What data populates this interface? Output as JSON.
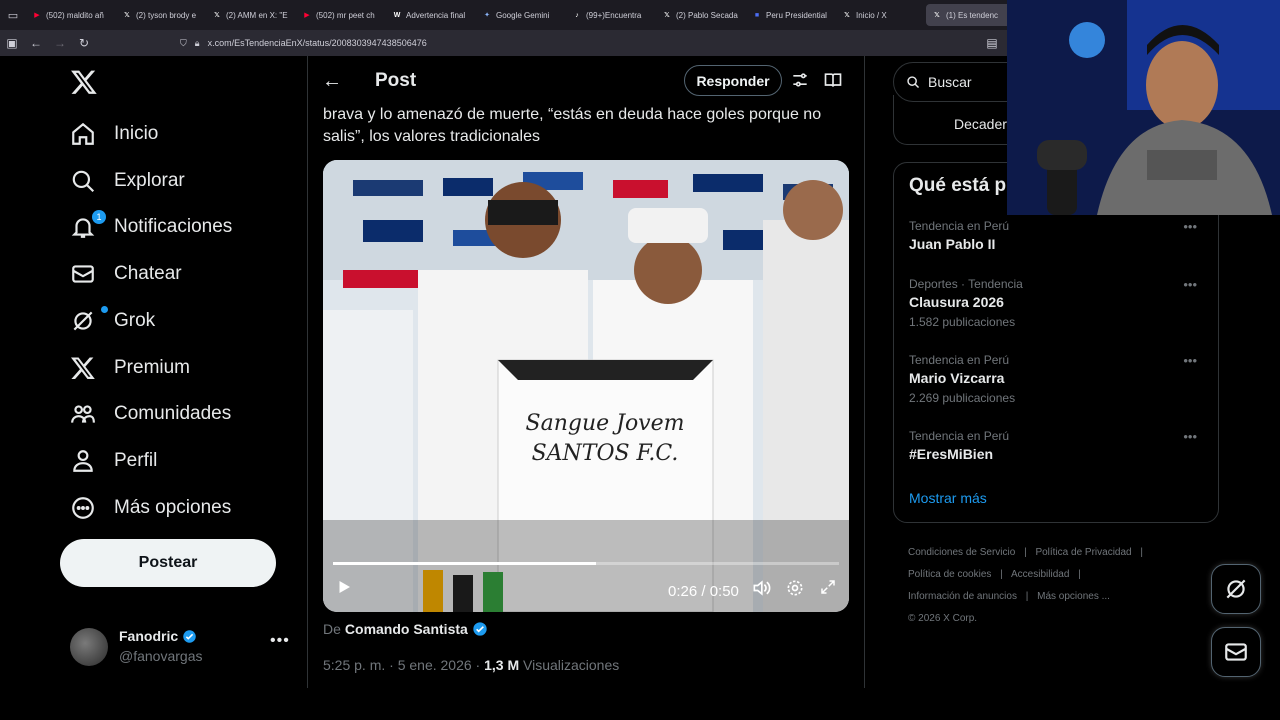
{
  "browser": {
    "tabs": [
      {
        "label": "(502) maldito añ",
        "icon": "youtube-icon",
        "color": "#ff0033"
      },
      {
        "label": "(2) tyson brody e",
        "icon": "x-icon",
        "color": "#ffffff"
      },
      {
        "label": "(2) AMM en X: \"E",
        "icon": "x-icon",
        "color": "#ffffff"
      },
      {
        "label": "(502) mr peet ch",
        "icon": "youtube-icon",
        "color": "#ff0033"
      },
      {
        "label": "Advertencia final",
        "icon": "wikipedia-icon",
        "color": "#ffffff"
      },
      {
        "label": "Google Gemini",
        "icon": "gemini-icon",
        "color": "#8ab4f8"
      },
      {
        "label": "(99+)Encuentra",
        "icon": "tiktok-icon",
        "color": "#ffffff"
      },
      {
        "label": "(2) Pablo Secada",
        "icon": "x-icon",
        "color": "#ffffff"
      },
      {
        "label": "Peru Presidential",
        "icon": "generic-icon",
        "color": "#4c6ef5"
      },
      {
        "label": "Inicio / X",
        "icon": "x-icon",
        "color": "#ffffff"
      },
      {
        "label": "(1) Es tendenc",
        "icon": "x-icon",
        "color": "#ffffff"
      }
    ],
    "url": "x.com/EsTendenciaEnX/status/2008303947438506476"
  },
  "nav": {
    "items": [
      {
        "label": "Inicio",
        "icon": "home-icon"
      },
      {
        "label": "Explorar",
        "icon": "search-icon"
      },
      {
        "label": "Notificaciones",
        "icon": "bell-icon",
        "badge": "1"
      },
      {
        "label": "Chatear",
        "icon": "mail-icon"
      },
      {
        "label": "Grok",
        "icon": "grok-icon"
      },
      {
        "label": "Premium",
        "icon": "x-icon"
      },
      {
        "label": "Comunidades",
        "icon": "people-icon"
      },
      {
        "label": "Perfil",
        "icon": "person-icon"
      },
      {
        "label": "Más opciones",
        "icon": "more-circle-icon"
      }
    ],
    "post_button": "Postear",
    "account": {
      "name": "Fanodric",
      "handle": "@fanovargas"
    }
  },
  "header": {
    "title": "Post",
    "reply_button": "Responder"
  },
  "post": {
    "text": "brava y lo amenazó de muerte, “estás en deuda hace goles porque no salis”, los valores tradicionales",
    "video": {
      "time": "0:26 / 0:50",
      "progress": 0.52
    },
    "source_prefix": "De",
    "source_name": "Comando Santista",
    "timestamp": "5:25 p. m. · 5 ene. 2026 · ",
    "views_count": "1,3 M",
    "views_label": " Visualizaciones"
  },
  "sidebar": {
    "search_placeholder": "Buscar",
    "partial_name": "Decader",
    "trends_title": "Qué está p",
    "trends": [
      {
        "category": "Tendencia en Perú",
        "name": "Juan Pablo II",
        "count": ""
      },
      {
        "category": "Deportes · Tendencia",
        "name": "Clausura 2026",
        "count": "1.582 publicaciones"
      },
      {
        "category": "Tendencia en Perú",
        "name": "Mario Vizcarra",
        "count": "2.269 publicaciones"
      },
      {
        "category": "Tendencia en Perú",
        "name": "#EresMiBien",
        "count": ""
      }
    ],
    "show_more": "Mostrar más",
    "footer": {
      "links": [
        "Condiciones de Servicio",
        "Política de Privacidad",
        "Política de cookies",
        "Accesibilidad",
        "Información de anuncios",
        "Más opciones ..."
      ],
      "copyright": "© 2026 X Corp."
    }
  },
  "colors": {
    "accent": "#1d9bf0",
    "background": "#000000",
    "border": "#2f3336",
    "muted": "#71767b"
  }
}
